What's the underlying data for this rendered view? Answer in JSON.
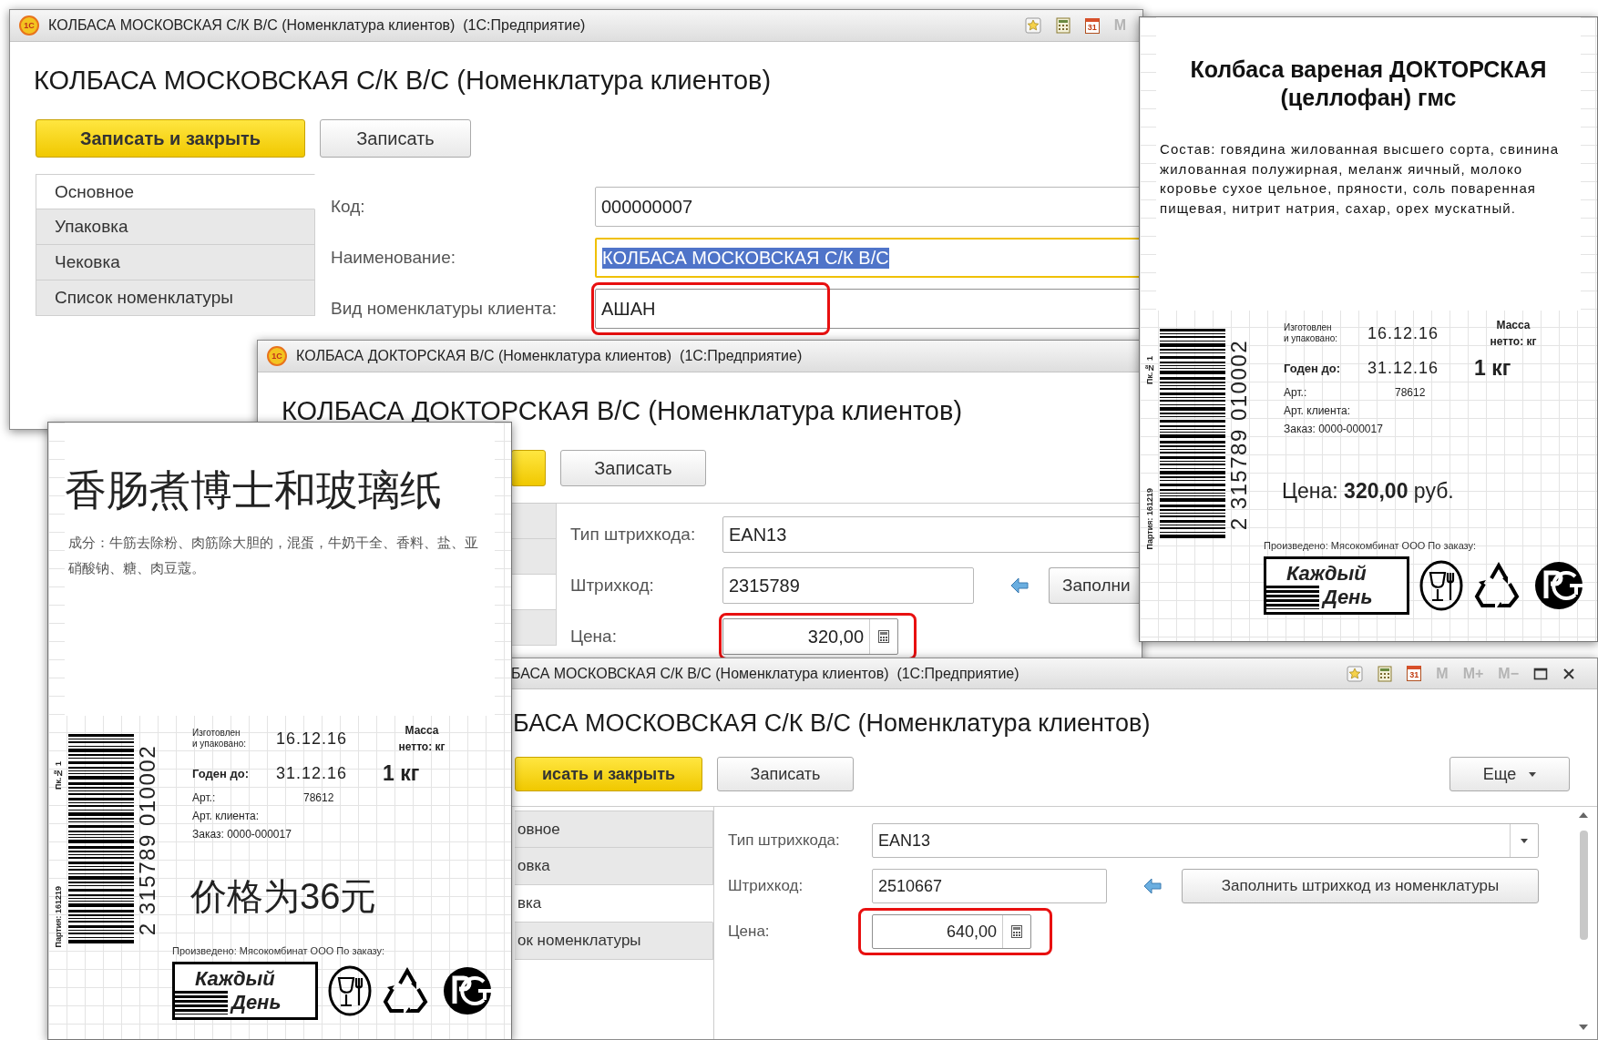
{
  "windows": [
    {
      "logo": "1С",
      "title": "КОЛБАСА МОСКОВСКАЯ С/К В/С (Номенклатура клиентов)  (1С:Предприятие)",
      "title_icons": [
        {
          "kind": "star"
        },
        {
          "kind": "calc"
        },
        {
          "kind": "calendar",
          "label": "31"
        },
        {
          "kind": "text",
          "label": "M"
        }
      ],
      "heading": "КОЛБАСА МОСКОВСКАЯ С/К В/С (Номенклатура клиентов)",
      "buttons": [
        {
          "kind": "primary",
          "label": "Записать и закрыть"
        },
        {
          "kind": "default",
          "label": "Записать"
        }
      ],
      "tabs": [
        {
          "label": "Основное",
          "selected": true
        },
        {
          "label": "Упаковка",
          "selected": false
        },
        {
          "label": "Чековка",
          "selected": false
        },
        {
          "label": "Список номенклатуры",
          "selected": false
        }
      ],
      "fields": [
        {
          "kind": "text",
          "label": "Код:",
          "value": "000000007",
          "focused": false,
          "text_selected": false,
          "marked": false
        },
        {
          "kind": "text",
          "label": "Наименование:",
          "value": "КОЛБАСА МОСКОВСКАЯ С/К В/С",
          "focused": true,
          "text_selected": true,
          "marked": false
        },
        {
          "kind": "text",
          "label": "Вид номенклатуры клиента:",
          "value": "АШАН",
          "focused": false,
          "text_selected": false,
          "marked": true
        }
      ]
    },
    {
      "logo": "1С",
      "title": "КОЛБАСА ДОКТОРСКАЯ В/С (Номенклатура клиентов)  (1С:Предприятие)",
      "heading": "КОЛБАСА ДОКТОРСКАЯ В/С (Номенклатура клиентов)",
      "buttons": [
        {
          "kind": "primary"
        },
        {
          "kind": "default",
          "label": "Записать"
        }
      ],
      "fields": [
        {
          "kind": "text",
          "label": "Тип штрихкода:",
          "value": "EAN13",
          "focused": false,
          "text_selected": false,
          "marked": false
        },
        {
          "kind": "barcode",
          "label": "Штрихкод:",
          "value": "2315789",
          "action": "Заполни",
          "focused": false,
          "text_selected": false,
          "marked": false
        },
        {
          "kind": "price",
          "label": "Цена:",
          "value": "320,00",
          "focused": false,
          "text_selected": false,
          "marked": true
        }
      ]
    },
    {
      "title": "БАСА МОСКОВСКАЯ С/К В/С (Номенклатура клиентов)  (1С:Предприятие)",
      "title_icons": [
        {
          "kind": "star"
        },
        {
          "kind": "calc"
        },
        {
          "kind": "calendar",
          "label": "31"
        },
        {
          "kind": "text",
          "label": "M"
        },
        {
          "kind": "text",
          "label": "M+"
        },
        {
          "kind": "text",
          "label": "M−"
        },
        {
          "kind": "maximize"
        },
        {
          "kind": "close"
        }
      ],
      "heading": "БАСА МОСКОВСКАЯ С/К В/С (Номенклатура клиентов)",
      "buttons": [
        {
          "kind": "primary",
          "label": "исать и закрыть"
        },
        {
          "kind": "default",
          "label": "Записать"
        },
        {
          "kind": "more",
          "label": "Еще"
        }
      ],
      "tabs": [
        {
          "label": "овное",
          "selected": false
        },
        {
          "label": "овка",
          "selected": false
        },
        {
          "label": "вка",
          "selected": true
        },
        {
          "label": "ок номенклатуры",
          "selected": false
        }
      ],
      "fields": [
        {
          "kind": "combo",
          "label": "Тип штрихкода:",
          "value": "EAN13",
          "focused": false,
          "text_selected": false,
          "marked": false
        },
        {
          "kind": "barcode",
          "label": "Штрихкод:",
          "value": "2510667",
          "action": "Заполнить штрихкод из номенклатуры",
          "focused": false,
          "text_selected": false,
          "marked": false
        },
        {
          "kind": "price",
          "label": "Цена:",
          "value": "640,00",
          "focused": false,
          "text_selected": false,
          "marked": true
        }
      ]
    }
  ],
  "labels": [
    {
      "title": "Колбаса вареная ДОКТОРСКАЯ (целлофан) гмс",
      "composition": "Состав: говядина жилованная высшего сорта, свинина жилованная полужирная, меланж яичный, молоко коровье сухое цельное, пряности, соль поваренная пищевая, нитрит натрия, сахар, орех мускатный.",
      "pack_no": "Пк.№ 1",
      "batch": "Партия: 161219",
      "barcode_digits": "2 315789 010002",
      "made_label": [
        "Изготовлен",
        "и упаковано:"
      ],
      "made_date": "16.12.16",
      "best_label": "Годен до:",
      "best_date": "31.12.16",
      "mass_label": "Масса нетто: кг",
      "mass": "1 кг",
      "article_label": "Арт.:",
      "article": "78612",
      "client_article_label": "Арт. клиента:",
      "order": "Заказ: 0000-000017",
      "price": "Цена: **320,00** руб.",
      "producer": "Произведено: Мясокомбинат ООО По заказу:",
      "logo_lines": [
        "Каждый",
        "День"
      ]
    },
    {
      "title": "香肠煮博士和玻璃纸",
      "composition": "成分：牛筋去除粉、肉筋除大胆的，混蛋，牛奶干全、香料、盐、亚硝酸钠、糖、肉豆蔻。",
      "pack_no": "Пк.№ 1",
      "batch": "Партия: 161219",
      "barcode_digits": "2 315789 010002",
      "made_label": [
        "Изготовлен",
        "и упаковано:"
      ],
      "made_date": "16.12.16",
      "best_label": "Годен до:",
      "best_date": "31.12.16",
      "mass_label": "Масса нетто: кг",
      "mass": "1 кг",
      "article_label": "Арт.:",
      "article": "78612",
      "client_article_label": "Арт. клиента:",
      "order": "Заказ: 0000-000017",
      "price": "价格为36元",
      "producer": "Произведено: Мясокомбинат ООО По заказу:",
      "logo_lines": [
        "Каждый",
        "День"
      ]
    }
  ]
}
